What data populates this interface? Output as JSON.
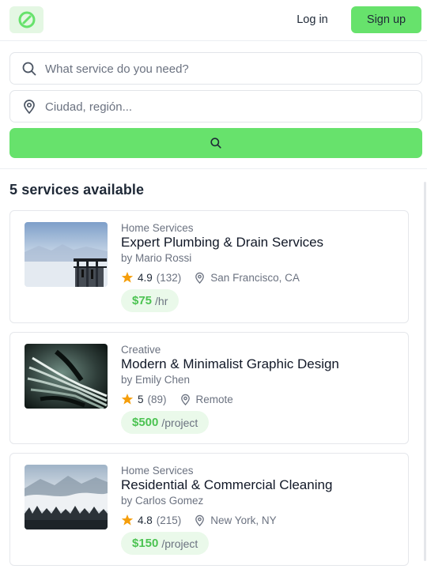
{
  "header": {
    "logo_icon": "leaf-circle-icon",
    "login_label": "Log in",
    "signup_label": "Sign up"
  },
  "search": {
    "service_placeholder": "What service do you need?",
    "location_placeholder": "Ciudad, región...",
    "button_icon": "search-icon"
  },
  "results": {
    "title": "5 services available",
    "items": [
      {
        "category": "Home Services",
        "title": "Expert Plumbing & Drain Services",
        "provider": "by Mario Rossi",
        "rating": "4.9",
        "reviews": "(132)",
        "location": "San Francisco, CA",
        "price": "$75",
        "unit": "/hr"
      },
      {
        "category": "Creative",
        "title": "Modern & Minimalist Graphic Design",
        "provider": "by Emily Chen",
        "rating": "5",
        "reviews": "(89)",
        "location": "Remote",
        "price": "$500",
        "unit": "/project"
      },
      {
        "category": "Home Services",
        "title": "Residential & Commercial Cleaning",
        "provider": "by Carlos Gomez",
        "rating": "4.8",
        "reviews": "(215)",
        "location": "New York, NY",
        "price": "$150",
        "unit": "/project"
      }
    ]
  },
  "colors": {
    "accent": "#67e26c",
    "accent_text": "#4cc352",
    "price_bg": "#eaf9ea",
    "star": "#f59e0b"
  }
}
